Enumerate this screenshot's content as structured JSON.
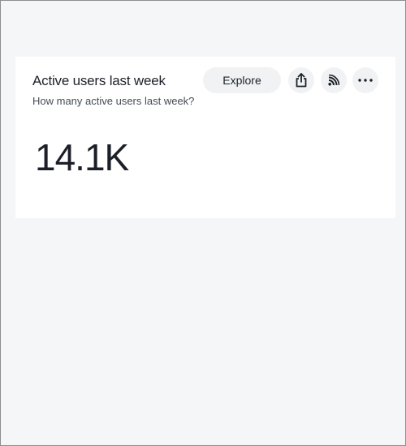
{
  "card": {
    "title": "Active users last week",
    "subtitle": "How many active users last week?",
    "metric_value": "14.1K"
  },
  "actions": {
    "explore_label": "Explore",
    "share_icon": "share-icon",
    "feed_icon": "rss-feed-icon",
    "more_icon": "more-horizontal-icon"
  },
  "colors": {
    "page_background": "#f5f6f8",
    "card_background": "#ffffff",
    "button_background": "#f1f2f4",
    "text_primary": "#1d2128",
    "text_secondary": "#454b55"
  }
}
